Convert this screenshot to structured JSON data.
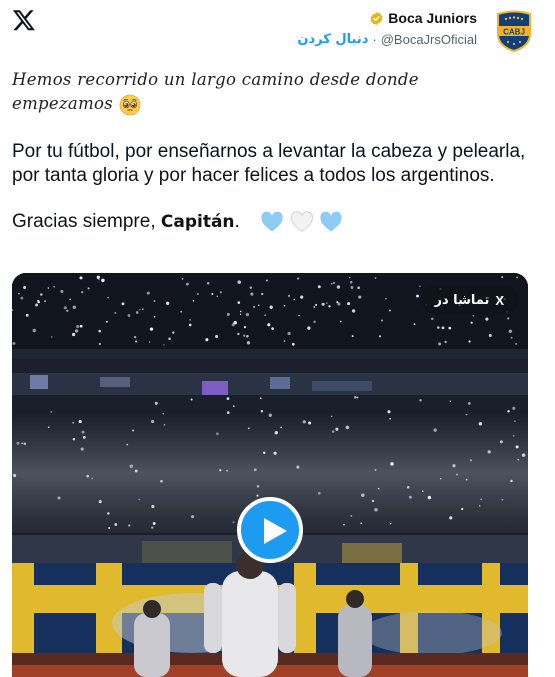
{
  "author": {
    "name": "Boca Juniors",
    "handle": "@BocaJrsOficial",
    "separator": "·",
    "follow_label": "دنبال کردن",
    "avatar_text": "CABJ"
  },
  "tweet": {
    "line1": "Hemos recorrido un largo camino desde donde",
    "line2": "empezamos",
    "para1": "Por tu fútbol, por enseñarnos a levantar la cabeza y pelearla, por tanta gloria y por hacer felices a todos los argentinos.",
    "para2_prefix": "Gracias siempre, ",
    "para2_bold": "Capitán",
    "para2_suffix": "."
  },
  "media": {
    "watch_label": "تماشا در",
    "watch_x": "X"
  },
  "icons": {
    "logo": "x-logo-icon",
    "verified": "verified-badge-icon",
    "play": "play-icon",
    "emoji_face": "pleading-face-emoji",
    "hearts": [
      "light-blue-heart-emoji",
      "white-heart-emoji",
      "light-blue-heart-emoji"
    ]
  },
  "colors": {
    "accent": "#1d9bf0",
    "verified_gold": "#e2b719",
    "boca_blue": "#103f79",
    "boca_gold": "#f3b229",
    "light_blue_heart": "#8ecbf2"
  }
}
